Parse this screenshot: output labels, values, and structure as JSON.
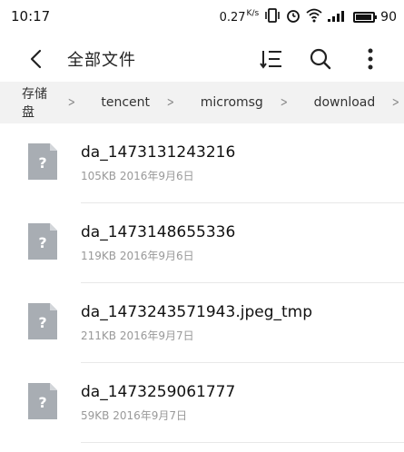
{
  "status_bar": {
    "time": "10:17",
    "speed": "0.27",
    "speed_unit": "K/s",
    "battery": "90"
  },
  "header": {
    "title": "全部文件",
    "icons": [
      "back-icon",
      "sort-icon",
      "search-icon",
      "more-icon"
    ]
  },
  "breadcrumb": {
    "items": [
      "存储盘",
      "tencent",
      "micromsg",
      "download"
    ],
    "separator": ">"
  },
  "files": [
    {
      "name": "da_1473131243216",
      "size": "105KB",
      "date": "2016年9月6日"
    },
    {
      "name": "da_1473148655336",
      "size": "119KB",
      "date": "2016年9月6日"
    },
    {
      "name": "da_1473243571943.jpeg_tmp",
      "size": "211KB",
      "date": "2016年9月7日"
    },
    {
      "name": "da_1473259061777",
      "size": "59KB",
      "date": "2016年9月7日"
    }
  ],
  "colors": {
    "icon_gray": "#a8adb3",
    "breadcrumb_bg": "#f2f2f2",
    "meta_text": "#999999"
  }
}
